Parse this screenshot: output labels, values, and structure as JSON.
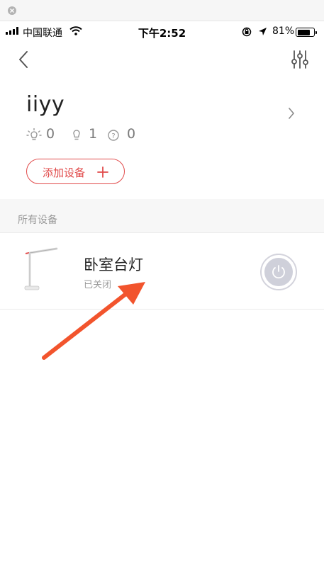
{
  "status_bar": {
    "carrier": "中国联通",
    "time": "下午2:52",
    "battery_pct": "81%",
    "battery_level": 0.81
  },
  "nav": {
    "back_icon": "chevron-left-icon",
    "settings_icon": "sliders-icon"
  },
  "home": {
    "name": "iiyy",
    "stats": [
      {
        "icon": "light-on-icon",
        "count": "0"
      },
      {
        "icon": "light-off-icon",
        "count": "1"
      },
      {
        "icon": "unknown-icon",
        "count": "0"
      }
    ]
  },
  "add_device": {
    "label": "添加设备"
  },
  "section": {
    "title": "所有设备"
  },
  "devices": [
    {
      "name": "卧室台灯",
      "status": "已关闭",
      "icon": "desk-lamp-icon",
      "power_icon": "power-icon"
    }
  ],
  "colors": {
    "accent": "#e14b4b",
    "annotation_arrow": "#f2542d",
    "power_off": "#cfd0da"
  }
}
